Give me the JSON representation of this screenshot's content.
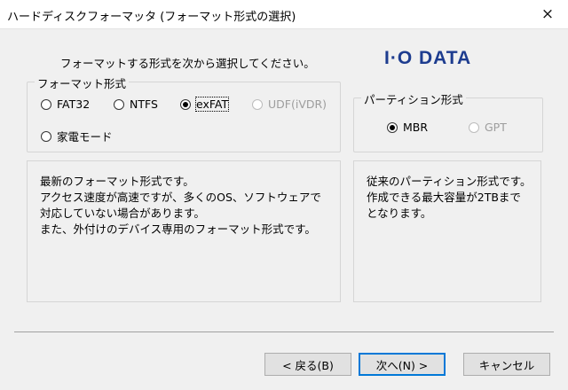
{
  "titlebar": {
    "title": "ハードディスクフォーマッタ (フォーマット形式の選択)",
    "close_icon": "×"
  },
  "instruction": "フォーマットする形式を次から選択してください。",
  "logo": "I·O DATA",
  "format_group": {
    "legend": "フォーマット形式",
    "options": [
      {
        "label": "FAT32",
        "selected": false,
        "disabled": false
      },
      {
        "label": "NTFS",
        "selected": false,
        "disabled": false
      },
      {
        "label": "exFAT",
        "selected": true,
        "disabled": false
      },
      {
        "label": "UDF(iVDR)",
        "selected": false,
        "disabled": true
      },
      {
        "label": "家電モード",
        "selected": false,
        "disabled": false
      }
    ]
  },
  "partition_group": {
    "legend": "パーティション形式",
    "options": [
      {
        "label": "MBR",
        "selected": true,
        "disabled": false
      },
      {
        "label": "GPT",
        "selected": false,
        "disabled": true
      }
    ]
  },
  "format_description": [
    "最新のフォーマット形式です。",
    "アクセス速度が高速ですが、多くのOS、ソフトウェアで",
    "対応していない場合があります。",
    "また、外付けのデバイス専用のフォーマット形式です。"
  ],
  "partition_description": [
    "従来のパーティション形式です。",
    "作成できる最大容量が2TBまで",
    "となります。"
  ],
  "buttons": {
    "back": "< 戻る(B)",
    "next": "次へ(N) >",
    "cancel": "キャンセル"
  },
  "colors": {
    "logo": "#1d3c8f",
    "default_button_border": "#0078d7",
    "disabled_text": "#9d9d9d"
  }
}
